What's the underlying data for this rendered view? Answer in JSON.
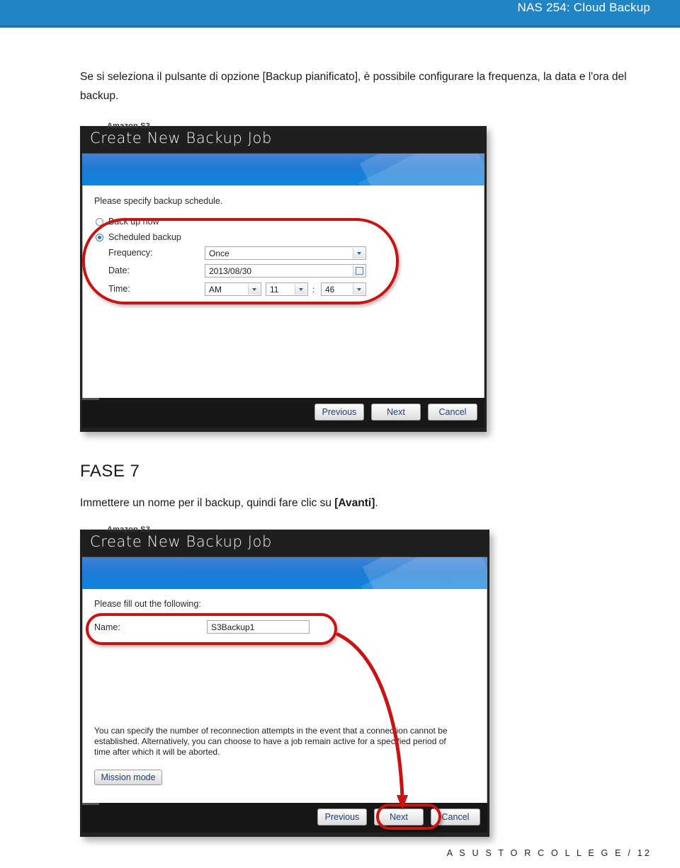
{
  "header": {
    "title": "NAS 254: Cloud Backup"
  },
  "intro": "Se si seleziona il pulsante di opzione [Backup pianificato], è possibile configurare la frequenza, la data e l'ora del backup.",
  "step": {
    "title": "FASE 7",
    "desc_before": "Immettere un nome per il backup, quindi fare clic su ",
    "desc_bold": "[Avanti]",
    "desc_after": "."
  },
  "footer": {
    "text": "A S U S T O R   C O L L E G E  /  12"
  },
  "colors": {
    "header_blue": "#2185c5",
    "header_rule": "#1c6fa5",
    "annotation_red": "#cc1111",
    "dialog_banner_blue": "#1f7ad4",
    "button_text_blue": "#1d3f78"
  },
  "figure1": {
    "ghost_window_title": "Amazon S3",
    "dialog_title": "Create New Backup Job",
    "instruction": "Please specify backup schedule.",
    "options": [
      {
        "label": "Back up now",
        "selected": false
      },
      {
        "label": "Scheduled backup",
        "selected": true
      }
    ],
    "fields": [
      {
        "label": "Frequency:",
        "value": "Once",
        "type": "combo"
      },
      {
        "label": "Date:",
        "value": "2013/08/30",
        "type": "date"
      }
    ],
    "time": {
      "label": "Time:",
      "meridiem": "AM",
      "hour": "11",
      "separator": ":",
      "minute": "46"
    },
    "buttons": [
      {
        "label": "Previous",
        "highlighted": false
      },
      {
        "label": "Next",
        "highlighted": false
      },
      {
        "label": "Cancel",
        "highlighted": false
      }
    ]
  },
  "figure2": {
    "ghost_window_title": "Amazon S3",
    "dialog_title": "Create New Backup Job",
    "instruction": "Please fill out the following:",
    "name_label": "Name:",
    "name_value": "S3Backup1",
    "description": "You can specify the number of reconnection attempts in the event that a connection cannot be established. Alternatively, you can choose to have a job remain active for a specified period of time after which it will be aborted.",
    "mission_mode_label": "Mission mode",
    "buttons": [
      {
        "label": "Previous",
        "highlighted": false
      },
      {
        "label": "Next",
        "highlighted": true
      },
      {
        "label": "Cancel",
        "highlighted": false
      }
    ]
  }
}
